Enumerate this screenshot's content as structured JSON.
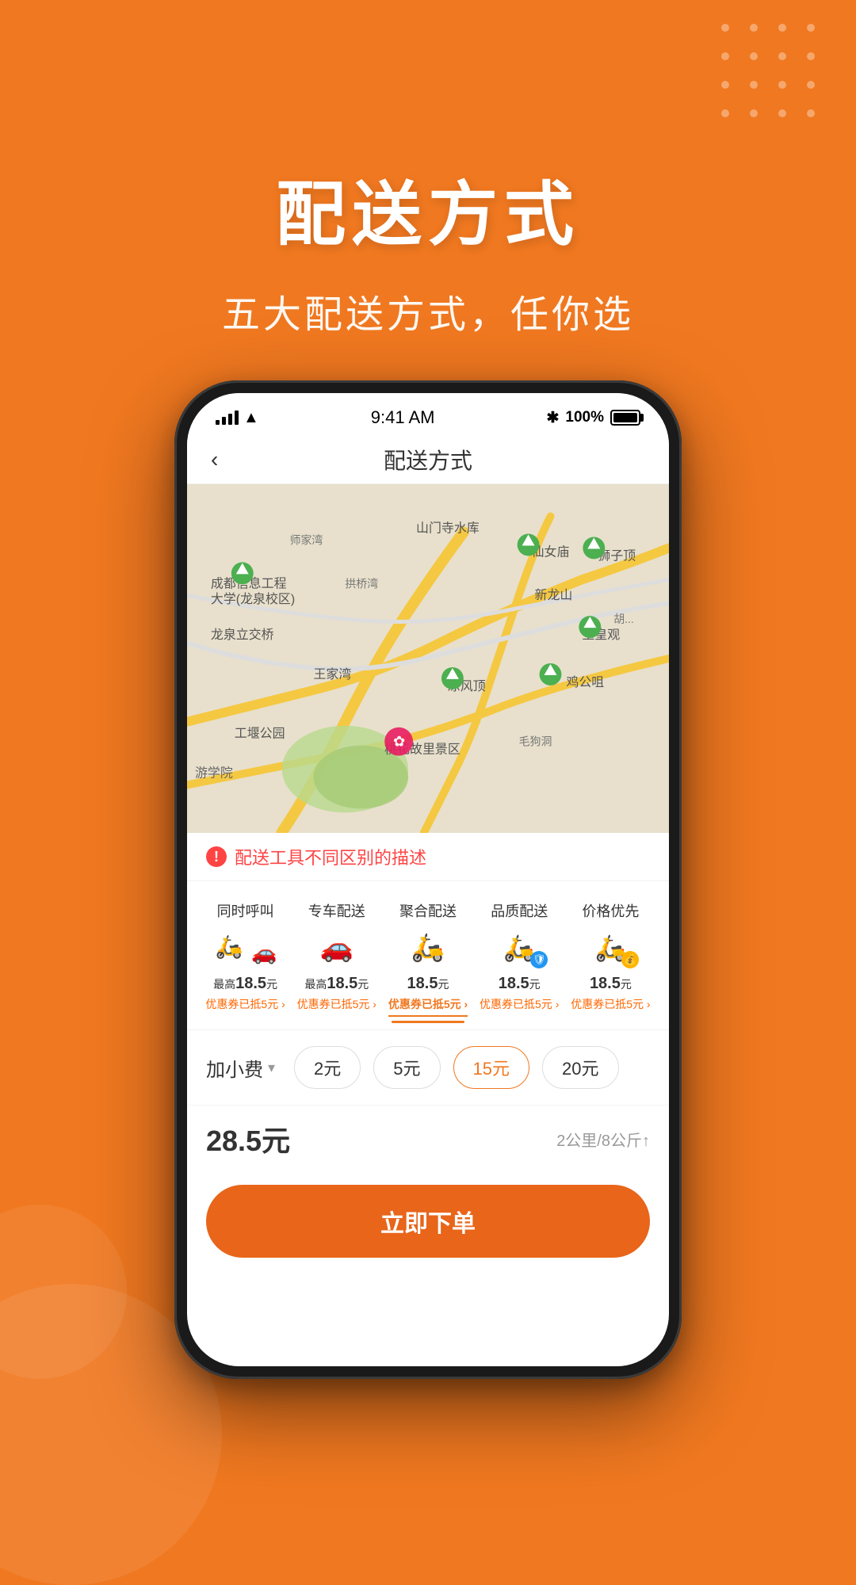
{
  "app": {
    "bg_color": "#F07820",
    "title": "配送方式",
    "subtitle": "五大配送方式，任你选"
  },
  "status_bar": {
    "time": "9:41 AM",
    "battery_percent": "100%",
    "bluetooth": "⌘"
  },
  "nav": {
    "back_icon": "‹",
    "title": "配送方式"
  },
  "warning": {
    "text": "配送工具不同区别的描述"
  },
  "delivery_options": [
    {
      "name": "同时呼叫",
      "price": "最高18.5元",
      "coupon": "优惠券已抵5元 ›",
      "type": "moto_car",
      "selected": false
    },
    {
      "name": "专车配送",
      "price": "最高18.5元",
      "coupon": "优惠券已抵5元 ›",
      "type": "car",
      "selected": false
    },
    {
      "name": "聚合配送",
      "price": "18.5元",
      "coupon": "优惠券已抵5元 ›",
      "type": "moto",
      "selected": true
    },
    {
      "name": "品质配送",
      "price": "18.5元",
      "coupon": "优惠券已抵5元 ›",
      "type": "moto_shield",
      "selected": false
    },
    {
      "name": "价格优先",
      "price": "18.5元",
      "coupon": "优惠券已抵5元 ›",
      "type": "moto_coin",
      "selected": false
    }
  ],
  "extra_fee": {
    "label": "加小费",
    "chips": [
      "2元",
      "5元",
      "15元",
      "20元"
    ],
    "selected_chip": "15元"
  },
  "total": {
    "price": "28.5元",
    "info": "2公里/8公斤↑"
  },
  "order_button": {
    "label": "立即下单"
  },
  "map": {
    "locations": [
      "成都信息工程大学(龙泉校区)",
      "龙泉立交桥",
      "山门寺水库",
      "仙女庙",
      "狮子顶",
      "新龙山",
      "玉皇观",
      "鸡公咀",
      "凉风顶",
      "王家湾",
      "桃花故里景区",
      "工堰公园"
    ]
  }
}
